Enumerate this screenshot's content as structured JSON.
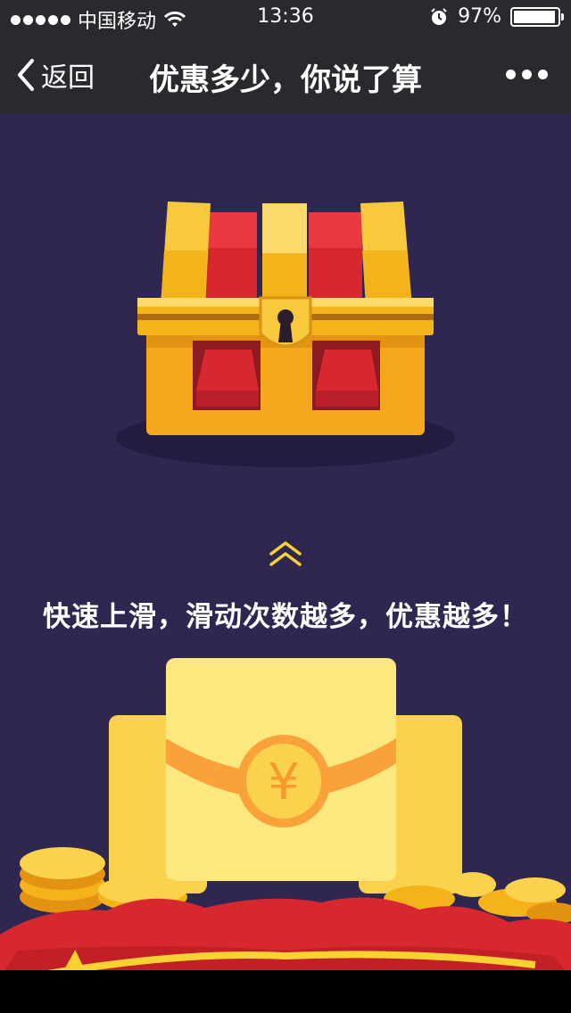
{
  "status_bar": {
    "carrier": "中国移动",
    "time": "13:36",
    "battery_text": "97%",
    "battery_level": 0.97,
    "icons": [
      "signal-dots-icon",
      "wifi-icon",
      "alarm-icon",
      "battery-icon"
    ]
  },
  "nav": {
    "back_label": "返回",
    "title": "优惠多少，你说了算"
  },
  "main": {
    "instruction": "快速上滑，滑动次数越多，优惠越多！",
    "coin_symbol": "¥"
  },
  "colors": {
    "background": "#2f2750",
    "bar": "#2a2a2e",
    "gold": "#f5b31b",
    "red": "#d7282f",
    "chevron": "#f7d232"
  }
}
